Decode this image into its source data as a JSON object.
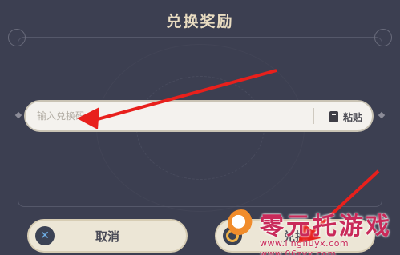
{
  "dialog": {
    "title": "兑换奖励"
  },
  "redeem": {
    "placeholder": "输入兑换码",
    "paste_label": "粘贴"
  },
  "buttons": {
    "cancel_label": "取消",
    "confirm_label": "兑换"
  },
  "watermark": {
    "text": "零元托游戏",
    "url": "www.lingliuyx.com  www.06zyx.com"
  },
  "colors": {
    "background": "#3c3f51",
    "title": "#e9dcc1",
    "button": "#ece6d6",
    "arrow": "#e8201c",
    "watermark": "#c92a5a"
  },
  "icons": {
    "paste": "clipboard-icon",
    "cancel": "close-x-icon",
    "confirm": "circle-o-icon"
  }
}
